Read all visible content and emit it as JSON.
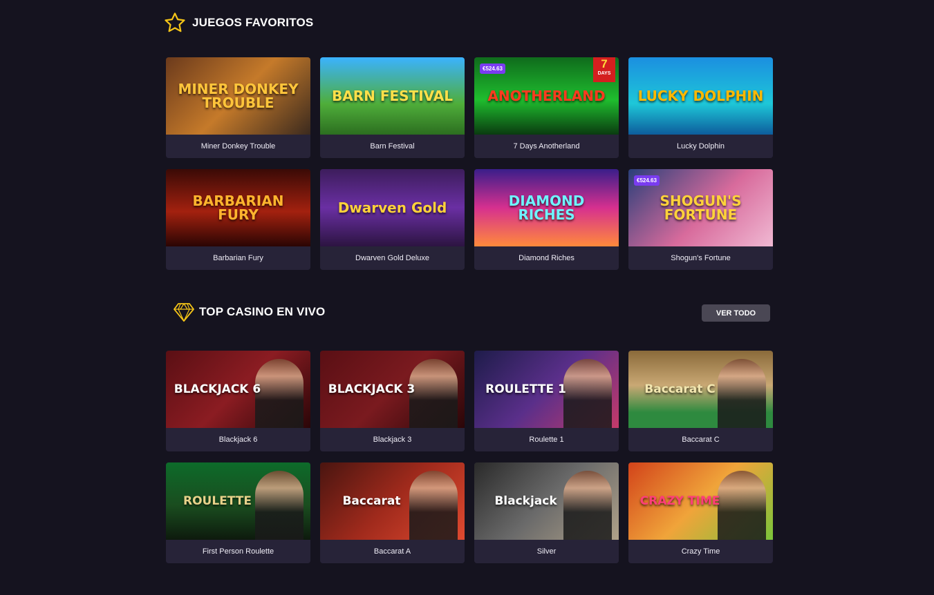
{
  "favorites": {
    "title": "JUEGOS FAVORITOS",
    "icon": "star-icon",
    "games": [
      {
        "name": "Miner Donkey Trouble",
        "art": "MINER DONKEY TROUBLE",
        "badge": "",
        "days": "",
        "bg": "linear-gradient(135deg,#6b3a1c,#c57a2a 50%,#3b2a1e)",
        "art_color": "#ffc53b"
      },
      {
        "name": "Barn Festival",
        "art": "BARN FESTIVAL",
        "badge": "",
        "days": "",
        "bg": "linear-gradient(180deg,#3bb2ff,#4fae3a 60%,#2c6e20)",
        "art_color": "#ffe04a"
      },
      {
        "name": "7 Days Anotherland",
        "art": "ANOTHERLAND",
        "badge": "€524.63",
        "days": "7",
        "days_label": "DAYS",
        "bg": "linear-gradient(180deg,#0f6b1c,#1fbd2e 55%,#0a3b10)",
        "art_color": "#ff3b1f"
      },
      {
        "name": "Lucky Dolphin",
        "art": "LUCKY DOLPHIN",
        "badge": "",
        "days": "",
        "bg": "linear-gradient(180deg,#1b8fe0,#1ec7d8 60%,#0d5c9c)",
        "art_color": "#ffb800"
      },
      {
        "name": "Barbarian Fury",
        "art": "BARBARIAN FURY",
        "badge": "",
        "days": "",
        "bg": "linear-gradient(180deg,#3a0a06,#a3210f 55%,#2a0503)",
        "art_color": "#ffb52e"
      },
      {
        "name": "Dwarven Gold Deluxe",
        "art": "Dwarven Gold",
        "badge": "",
        "days": "",
        "bg": "linear-gradient(180deg,#3d1d5c,#6a2fa3 50%,#2c1441)",
        "art_color": "#ffd23a"
      },
      {
        "name": "Diamond Riches",
        "art": "DIAMOND RICHES",
        "badge": "",
        "days": "",
        "bg": "linear-gradient(180deg,#3a1e8a,#d6308f 50%,#ff8a3b)",
        "art_color": "#6ff3ff"
      },
      {
        "name": "Shogun's Fortune",
        "art": "SHOGUN'S FORTUNE",
        "badge": "€524.63",
        "days": "",
        "bg": "linear-gradient(135deg,#2a3f7a,#d86b9c 55%,#f0b9d3)",
        "art_color": "#ffd23a"
      }
    ]
  },
  "live": {
    "title": "TOP CASINO EN VIVO",
    "icon": "diamond-icon",
    "view_all": "VER TODO",
    "games": [
      {
        "name": "Blackjack 6",
        "art": "BLACKJACK 6",
        "bg": "linear-gradient(135deg,#5a0f14,#8b1c22 50%,#2a0608)",
        "art_color": "#ffffff"
      },
      {
        "name": "Blackjack 3",
        "art": "BLACKJACK 3",
        "bg": "linear-gradient(135deg,#5a0f14,#7a1a1f 50%,#2a0608)",
        "art_color": "#ffffff"
      },
      {
        "name": "Roulette 1",
        "art": "ROULETTE 1",
        "bg": "linear-gradient(135deg,#1e1c4a,#5a2f8a 50%,#c53a6a)",
        "art_color": "#ffffff"
      },
      {
        "name": "Baccarat C",
        "art": "Baccarat C",
        "bg": "linear-gradient(180deg,#8a6a3a,#c9a874 45%,#2e8a3f 80%)",
        "art_color": "#f3e7b0"
      },
      {
        "name": "First Person Roulette",
        "art": "ROULETTE",
        "bg": "linear-gradient(180deg,#0d6b2a,#1a4d1f 55%,#0d1a0d)",
        "art_color": "#e8d28a"
      },
      {
        "name": "Baccarat A",
        "art": "Baccarat",
        "bg": "linear-gradient(135deg,#4a1510,#a02a1c 50%,#e04a30)",
        "art_color": "#ffffff"
      },
      {
        "name": "Silver",
        "art": "Blackjack",
        "bg": "linear-gradient(135deg,#2a2a2a,#6a6a6a 50%,#b0a28a)",
        "art_color": "#ffffff"
      },
      {
        "name": "Crazy Time",
        "art": "CRAZY TIME",
        "bg": "linear-gradient(135deg,#d2431a,#f0a43a 50%,#7ac43a)",
        "art_color": "#ff3d7a"
      }
    ]
  }
}
